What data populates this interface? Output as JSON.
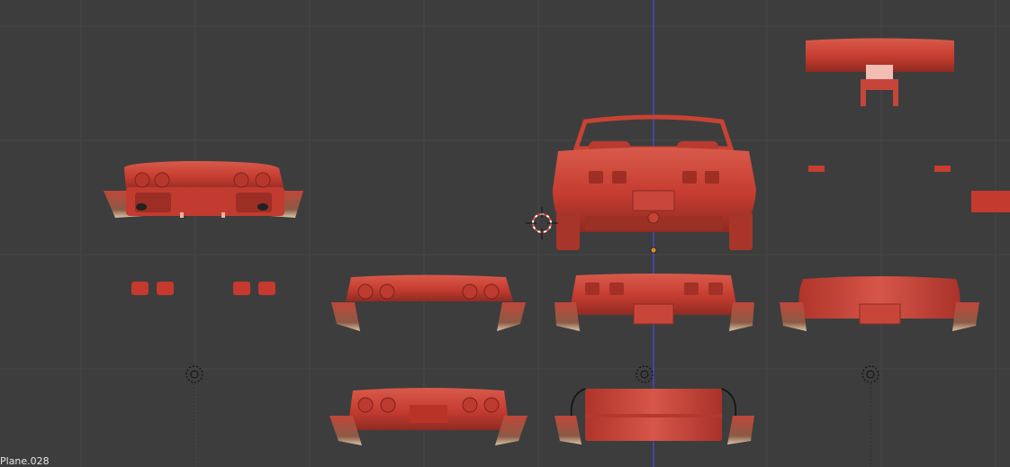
{
  "viewport": {
    "background": "#3d3d3d",
    "grid_color": "#474747",
    "axis_color": "#4a4aff",
    "object_color": "#c93e32",
    "active_object_name": "Plane.028"
  },
  "objects": [
    {
      "name": "rear-bumper-assembly-angled"
    },
    {
      "name": "car-rear-full"
    },
    {
      "name": "spoiler-wing"
    },
    {
      "name": "taillight-lens-set"
    },
    {
      "name": "rear-panel-with-lights"
    },
    {
      "name": "rear-panel-with-plate"
    },
    {
      "name": "rear-panel-smooth"
    },
    {
      "name": "rear-panel-lower"
    },
    {
      "name": "rear-bumper-wrap"
    }
  ],
  "icons": [
    "3d-cursor-icon",
    "empty-object-icon",
    "origin-point-icon"
  ]
}
